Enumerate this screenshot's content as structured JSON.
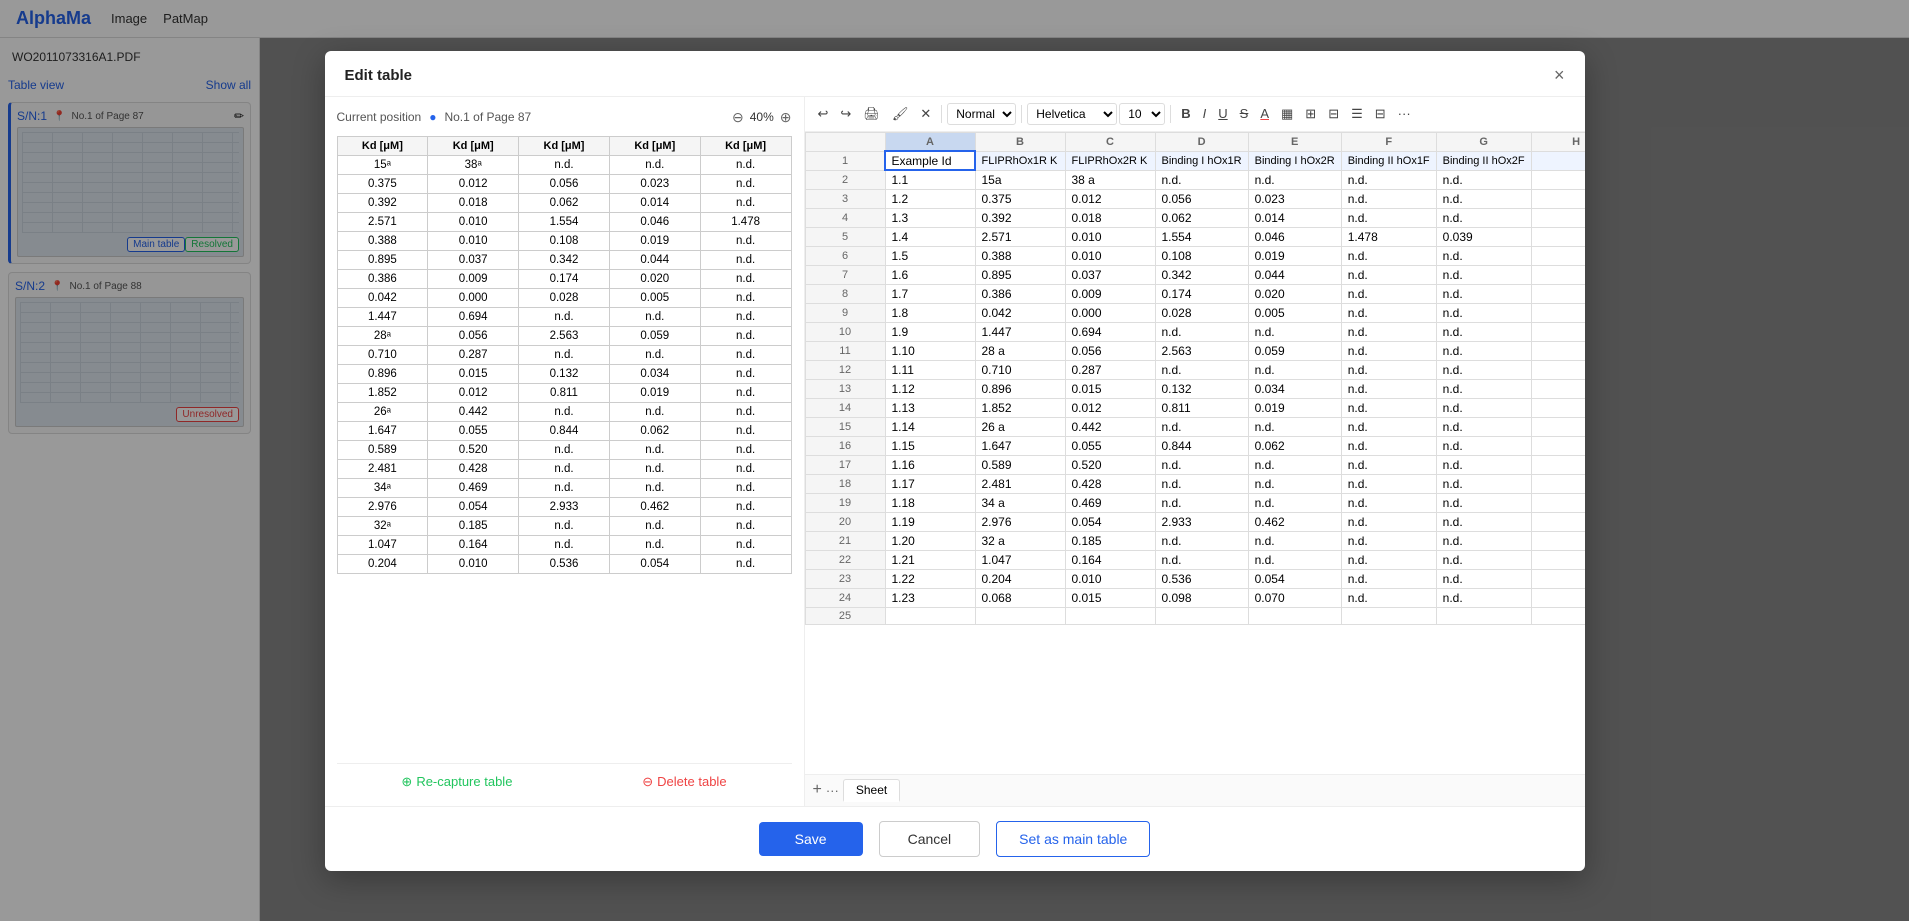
{
  "app": {
    "logo": "AlphaMa",
    "nav": [
      "Image",
      "PatMap"
    ],
    "doc_title": "WO2011073316A1.PDF"
  },
  "sidebar": {
    "view_label": "Table view",
    "show_label": "Show all",
    "items": [
      {
        "id": "SN1",
        "label": "S/N:1",
        "page": "No.1 of Page 87",
        "badge1": "Main table",
        "badge2": "Resolved"
      },
      {
        "id": "SN2",
        "label": "S/N:2",
        "page": "No.1 of Page 88",
        "badge1": "",
        "badge2": "Unresolved"
      }
    ]
  },
  "modal": {
    "title": "Edit table",
    "close_label": "×",
    "preview": {
      "position_label": "Current position",
      "position_value": "No.1 of Page 87",
      "zoom_value": "40%",
      "columns": [
        "Kd [μM]",
        "Kd [μM]",
        "Kd [μM]",
        "Kd [μM]",
        "Kd [μM]"
      ],
      "rows": [
        [
          "15ᵃ",
          "38ᵃ",
          "n.d.",
          "n.d.",
          "n.d."
        ],
        [
          "0.375",
          "0.012",
          "0.056",
          "0.023",
          "n.d."
        ],
        [
          "0.392",
          "0.018",
          "0.062",
          "0.014",
          "n.d."
        ],
        [
          "2.571",
          "0.010",
          "1.554",
          "0.046",
          "1.478"
        ],
        [
          "0.388",
          "0.010",
          "0.108",
          "0.019",
          "n.d."
        ],
        [
          "0.895",
          "0.037",
          "0.342",
          "0.044",
          "n.d."
        ],
        [
          "0.386",
          "0.009",
          "0.174",
          "0.020",
          "n.d."
        ],
        [
          "0.042",
          "0.000",
          "0.028",
          "0.005",
          "n.d."
        ],
        [
          "1.447",
          "0.694",
          "n.d.",
          "n.d.",
          "n.d."
        ],
        [
          "28ᵃ",
          "0.056",
          "2.563",
          "0.059",
          "n.d."
        ],
        [
          "0.710",
          "0.287",
          "n.d.",
          "n.d.",
          "n.d."
        ],
        [
          "0.896",
          "0.015",
          "0.132",
          "0.034",
          "n.d."
        ],
        [
          "1.852",
          "0.012",
          "0.811",
          "0.019",
          "n.d."
        ],
        [
          "26ᵃ",
          "0.442",
          "n.d.",
          "n.d.",
          "n.d."
        ],
        [
          "1.647",
          "0.055",
          "0.844",
          "0.062",
          "n.d."
        ],
        [
          "0.589",
          "0.520",
          "n.d.",
          "n.d.",
          "n.d."
        ],
        [
          "2.481",
          "0.428",
          "n.d.",
          "n.d.",
          "n.d."
        ],
        [
          "34ᵃ",
          "0.469",
          "n.d.",
          "n.d.",
          "n.d."
        ],
        [
          "2.976",
          "0.054",
          "2.933",
          "0.462",
          "n.d."
        ],
        [
          "32ᵃ",
          "0.185",
          "n.d.",
          "n.d.",
          "n.d."
        ],
        [
          "1.047",
          "0.164",
          "n.d.",
          "n.d.",
          "n.d."
        ],
        [
          "0.204",
          "0.010",
          "0.536",
          "0.054",
          "n.d."
        ]
      ],
      "recapture_label": "Re-capture table",
      "delete_label": "Delete table"
    },
    "spreadsheet": {
      "toolbar": {
        "undo": "↩",
        "redo": "↪",
        "print": "🖨",
        "format_paint": "🖌",
        "clear": "✕",
        "normal_mode": "Normal",
        "font": "Helvetica",
        "font_size": "10",
        "bold": "B",
        "italic": "I",
        "underline": "U",
        "strikethrough": "S",
        "font_color": "A",
        "highlight": "⬛",
        "borders": "⊞",
        "merge": "⊟",
        "align": "☰",
        "valign": "⊟",
        "more": "..."
      },
      "col_headers": [
        "",
        "A",
        "B",
        "C",
        "D",
        "E",
        "F",
        "G",
        "H"
      ],
      "rows": [
        {
          "num": 1,
          "cells": [
            "Example Id",
            "FLIPRhOx1R K",
            "FLIPRhOx2R K",
            "Binding I hOx1R",
            "Binding I hOx2R",
            "Binding II hOx1F",
            "Binding II hOx2F",
            ""
          ]
        },
        {
          "num": 2,
          "cells": [
            "1.1",
            "15a",
            "38 a",
            "n.d.",
            "n.d.",
            "n.d.",
            "n.d.",
            ""
          ]
        },
        {
          "num": 3,
          "cells": [
            "1.2",
            "0.375",
            "0.012",
            "0.056",
            "0.023",
            "n.d.",
            "n.d.",
            ""
          ]
        },
        {
          "num": 4,
          "cells": [
            "1.3",
            "0.392",
            "0.018",
            "0.062",
            "0.014",
            "n.d.",
            "n.d.",
            ""
          ]
        },
        {
          "num": 5,
          "cells": [
            "1.4",
            "2.571",
            "0.010",
            "1.554",
            "0.046",
            "1.478",
            "0.039",
            ""
          ]
        },
        {
          "num": 6,
          "cells": [
            "1.5",
            "0.388",
            "0.010",
            "0.108",
            "0.019",
            "n.d.",
            "n.d.",
            ""
          ]
        },
        {
          "num": 7,
          "cells": [
            "1.6",
            "0.895",
            "0.037",
            "0.342",
            "0.044",
            "n.d.",
            "n.d.",
            ""
          ]
        },
        {
          "num": 8,
          "cells": [
            "1.7",
            "0.386",
            "0.009",
            "0.174",
            "0.020",
            "n.d.",
            "n.d.",
            ""
          ]
        },
        {
          "num": 9,
          "cells": [
            "1.8",
            "0.042",
            "0.000",
            "0.028",
            "0.005",
            "n.d.",
            "n.d.",
            ""
          ]
        },
        {
          "num": 10,
          "cells": [
            "1.9",
            "1.447",
            "0.694",
            "n.d.",
            "n.d.",
            "n.d.",
            "n.d.",
            ""
          ]
        },
        {
          "num": 11,
          "cells": [
            "1.10",
            "28 a",
            "0.056",
            "2.563",
            "0.059",
            "n.d.",
            "n.d.",
            ""
          ]
        },
        {
          "num": 12,
          "cells": [
            "1.11",
            "0.710",
            "0.287",
            "n.d.",
            "n.d.",
            "n.d.",
            "n.d.",
            ""
          ]
        },
        {
          "num": 13,
          "cells": [
            "1.12",
            "0.896",
            "0.015",
            "0.132",
            "0.034",
            "n.d.",
            "n.d.",
            ""
          ]
        },
        {
          "num": 14,
          "cells": [
            "1.13",
            "1.852",
            "0.012",
            "0.811",
            "0.019",
            "n.d.",
            "n.d.",
            ""
          ]
        },
        {
          "num": 15,
          "cells": [
            "1.14",
            "26 a",
            "0.442",
            "n.d.",
            "n.d.",
            "n.d.",
            "n.d.",
            ""
          ]
        },
        {
          "num": 16,
          "cells": [
            "1.15",
            "1.647",
            "0.055",
            "0.844",
            "0.062",
            "n.d.",
            "n.d.",
            ""
          ]
        },
        {
          "num": 17,
          "cells": [
            "1.16",
            "0.589",
            "0.520",
            "n.d.",
            "n.d.",
            "n.d.",
            "n.d.",
            ""
          ]
        },
        {
          "num": 18,
          "cells": [
            "1.17",
            "2.481",
            "0.428",
            "n.d.",
            "n.d.",
            "n.d.",
            "n.d.",
            ""
          ]
        },
        {
          "num": 19,
          "cells": [
            "1.18",
            "34 a",
            "0.469",
            "n.d.",
            "n.d.",
            "n.d.",
            "n.d.",
            ""
          ]
        },
        {
          "num": 20,
          "cells": [
            "1.19",
            "2.976",
            "0.054",
            "2.933",
            "0.462",
            "n.d.",
            "n.d.",
            ""
          ]
        },
        {
          "num": 21,
          "cells": [
            "1.20",
            "32 a",
            "0.185",
            "n.d.",
            "n.d.",
            "n.d.",
            "n.d.",
            ""
          ]
        },
        {
          "num": 22,
          "cells": [
            "1.21",
            "1.047",
            "0.164",
            "n.d.",
            "n.d.",
            "n.d.",
            "n.d.",
            ""
          ]
        },
        {
          "num": 23,
          "cells": [
            "1.22",
            "0.204",
            "0.010",
            "0.536",
            "0.054",
            "n.d.",
            "n.d.",
            ""
          ]
        },
        {
          "num": 24,
          "cells": [
            "1.23",
            "0.068",
            "0.015",
            "0.098",
            "0.070",
            "n.d.",
            "n.d.",
            ""
          ]
        },
        {
          "num": 25,
          "cells": [
            "",
            "",
            "",
            "",
            "",
            "",
            "",
            ""
          ]
        }
      ],
      "sheet_name": "Sheet"
    },
    "footer": {
      "save_label": "Save",
      "cancel_label": "Cancel",
      "set_main_label": "Set as main table"
    }
  }
}
